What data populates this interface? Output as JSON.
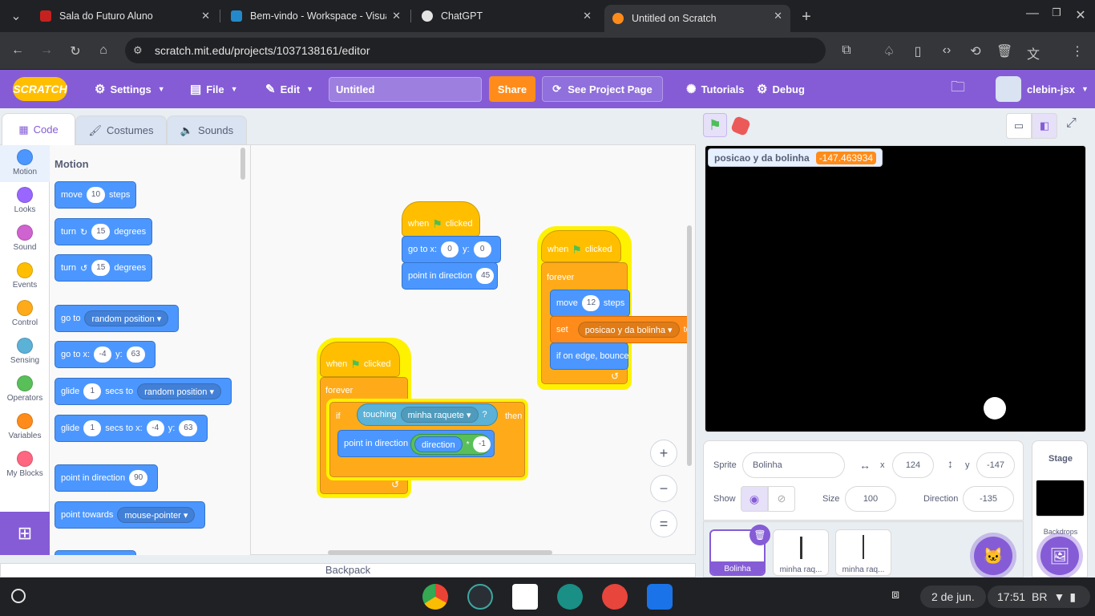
{
  "browser": {
    "tabs": [
      {
        "label": "Sala do Futuro Aluno",
        "active": false,
        "color": "#c5221f"
      },
      {
        "label": "Bem-vindo - Workspace - Visual",
        "active": false,
        "color": "#2489ca"
      },
      {
        "label": "ChatGPT",
        "active": false,
        "color": "#e3e3e3"
      },
      {
        "label": "Untitled on Scratch",
        "active": true,
        "color": "#ff8c1a"
      }
    ],
    "url": "scratch.mit.edu/projects/1037138161/editor"
  },
  "menubar": {
    "logo": "SCRATCH",
    "settings": "Settings",
    "file": "File",
    "edit": "Edit",
    "title_value": "Untitled",
    "share": "Share",
    "see_project": "See Project Page",
    "tutorials": "Tutorials",
    "debug": "Debug",
    "username": "clebin-jsx"
  },
  "editor_tabs": {
    "code": "Code",
    "costumes": "Costumes",
    "sounds": "Sounds"
  },
  "categories": [
    {
      "label": "Motion",
      "color": "#4c97ff"
    },
    {
      "label": "Looks",
      "color": "#9966ff"
    },
    {
      "label": "Sound",
      "color": "#cf63cf"
    },
    {
      "label": "Events",
      "color": "#ffbf00"
    },
    {
      "label": "Control",
      "color": "#ffab19"
    },
    {
      "label": "Sensing",
      "color": "#5cb1d6"
    },
    {
      "label": "Operators",
      "color": "#59c059"
    },
    {
      "label": "Variables",
      "color": "#ff8c1a"
    },
    {
      "label": "My Blocks",
      "color": "#ff6680"
    }
  ],
  "palette": {
    "heading": "Motion",
    "move": {
      "a": "move",
      "v": "10",
      "b": "steps"
    },
    "turn_cw": {
      "a": "turn",
      "v": "15",
      "b": "degrees"
    },
    "turn_ccw": {
      "a": "turn",
      "v": "15",
      "b": "degrees"
    },
    "goto": {
      "a": "go to",
      "dd": "random position"
    },
    "gotoxy": {
      "a": "go to x:",
      "x": "-4",
      "y_lbl": "y:",
      "y": "63"
    },
    "glide": {
      "a": "glide",
      "v": "1",
      "b": "secs to",
      "dd": "random position"
    },
    "glidexy": {
      "a": "glide",
      "v": "1",
      "b": "secs to x:",
      "x": "-4",
      "y_lbl": "y:",
      "y": "63"
    },
    "point": {
      "a": "point in direction",
      "v": "90"
    },
    "towards": {
      "a": "point towards",
      "dd": "mouse-pointer"
    }
  },
  "scripts": {
    "s1": {
      "hat_a": "when",
      "hat_b": "clicked",
      "goto_a": "go to x:",
      "goto_x": "0",
      "goto_y_lbl": "y:",
      "goto_y": "0",
      "point_a": "point in direction",
      "point_v": "45"
    },
    "s2": {
      "hat_a": "when",
      "hat_b": "clicked",
      "forever": "forever",
      "move_a": "move",
      "move_v": "12",
      "move_b": "steps",
      "set_a": "set",
      "set_dd": "posicao y da bolinha",
      "set_b": "to",
      "bounce": "if on edge, bounce"
    },
    "s3": {
      "hat_a": "when",
      "hat_b": "clicked",
      "forever": "forever",
      "if_a": "if",
      "touch_a": "touching",
      "touch_dd": "minha raquete",
      "touch_q": "?",
      "then": "then",
      "point_a": "point in direction",
      "dir": "direction",
      "op": "*",
      "mult": "-1"
    }
  },
  "backpack": "Backpack",
  "zoom": {
    "in": "+",
    "out": "−",
    "reset": "="
  },
  "monitor": {
    "label": "posicao y da bolinha",
    "value": "-147.463934"
  },
  "sprite_info": {
    "sprite_lbl": "Sprite",
    "sprite_name": "Bolinha",
    "x_lbl": "x",
    "x": "124",
    "y_lbl": "y",
    "y": "-147",
    "show_lbl": "Show",
    "size_lbl": "Size",
    "size": "100",
    "dir_lbl": "Direction",
    "dir": "-135"
  },
  "sprites": [
    {
      "name": "Bolinha",
      "selected": true
    },
    {
      "name": "minha raq...",
      "selected": false
    },
    {
      "name": "minha raq...",
      "selected": false
    }
  ],
  "stage_panel": {
    "title": "Stage",
    "backdrops": "Backdrops"
  },
  "taskbar": {
    "date": "2 de jun.",
    "time": "17:51",
    "locale": "BR"
  },
  "colors": {
    "scratch_purple": "#855cd6",
    "share_orange": "#ff8c1a"
  }
}
